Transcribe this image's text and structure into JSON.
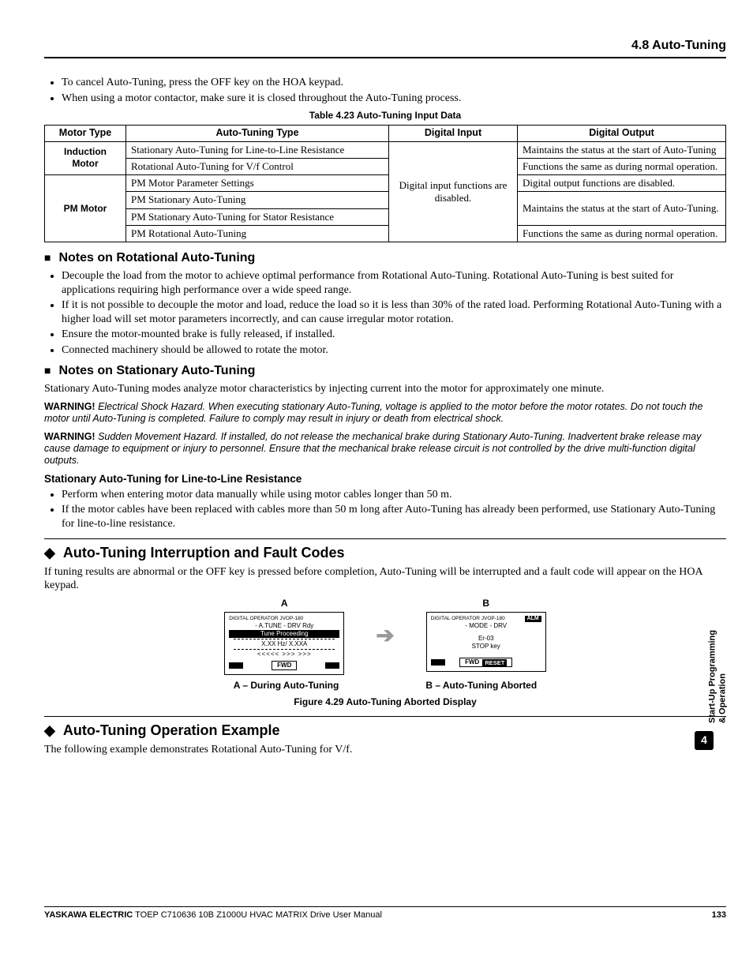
{
  "header": {
    "section": "4.8 Auto-Tuning"
  },
  "intro_bullets": [
    "To cancel Auto-Tuning, press the OFF key on the HOA keypad.",
    "When using a motor contactor, make sure it is closed throughout the Auto-Tuning process."
  ],
  "table": {
    "caption": "Table 4.23  Auto-Tuning Input Data",
    "headers": [
      "Motor Type",
      "Auto-Tuning Type",
      "Digital Input",
      "Digital Output"
    ],
    "digital_input_text": "Digital input functions are disabled.",
    "rows": [
      {
        "motor_type": "Induction Motor",
        "tuning": "Stationary Auto-Tuning for Line-to-Line Resistance",
        "output": "Maintains the status at the start of Auto-Tuning"
      },
      {
        "tuning": "Rotational Auto-Tuning for V/f Control",
        "output": "Functions the same as during normal operation."
      },
      {
        "motor_type": "PM Motor",
        "tuning": "PM Motor Parameter Settings",
        "output": "Digital output functions are disabled."
      },
      {
        "tuning": "PM Stationary Auto-Tuning",
        "output_merged": "Maintains the status at the start of Auto-Tuning."
      },
      {
        "tuning": "PM Stationary Auto-Tuning for Stator Resistance"
      },
      {
        "tuning": "PM Rotational Auto-Tuning",
        "output": "Functions the same as during normal operation."
      }
    ]
  },
  "sec_rotational": {
    "title": "Notes on Rotational Auto-Tuning",
    "bullets": [
      "Decouple the load from the motor to achieve optimal performance from Rotational Auto-Tuning. Rotational Auto-Tuning is best suited for applications requiring high performance over a wide speed range.",
      "If it is not possible to decouple the motor and load, reduce the load so it is less than 30% of the rated load. Performing Rotational Auto-Tuning with a higher load will set motor parameters incorrectly, and can cause irregular motor rotation.",
      "Ensure the motor-mounted brake is fully released, if installed.",
      "Connected machinery should be allowed to rotate the motor."
    ]
  },
  "sec_stationary": {
    "title": "Notes on Stationary Auto-Tuning",
    "intro": "Stationary Auto-Tuning modes analyze motor characteristics by injecting current into the motor for approximately one minute.",
    "warnings": [
      {
        "lead": "WARNING!",
        "body": "Electrical Shock Hazard. When executing stationary Auto-Tuning, voltage is applied to the motor before the motor rotates. Do not touch the motor until Auto-Tuning is completed. Failure to comply may result in injury or death from electrical shock."
      },
      {
        "lead": "WARNING!",
        "body": "Sudden Movement Hazard. If installed, do not release the mechanical brake during Stationary Auto-Tuning. Inadvertent brake release may cause damage to equipment or injury to personnel. Ensure that the mechanical brake release circuit is not controlled by the drive multi-function digital outputs."
      }
    ],
    "sub_title": "Stationary Auto-Tuning for Line-to-Line Resistance",
    "sub_bullets": [
      "Perform when entering motor data manually while using motor cables longer than 50 m.",
      "If the motor cables have been replaced with cables more than 50 m long after Auto-Tuning has already been performed, use Stationary Auto-Tuning for line-to-line resistance."
    ]
  },
  "sec_interrupt": {
    "title": "Auto-Tuning Interruption and Fault Codes",
    "intro": "If tuning results are abnormal or the OFF key is pressed before completion, Auto-Tuning will be interrupted and a fault code will appear on the HOA keypad.",
    "figure": {
      "labelA": "A",
      "labelB": "B",
      "panelA": {
        "top_left": "DIGITAL OPERATOR  JVOP-180",
        "top_right": "",
        "line1": "- A.TUNE -   DRV   Rdy",
        "inv": "Tune Proceeding",
        "line2": "X.XX Hz/  X.XXA",
        "sym": "<<<<<    >>>   >>>",
        "fwd": "FWD",
        "reset": ""
      },
      "panelB": {
        "top_left": "DIGITAL OPERATOR  JVOP-180",
        "top_right": "ALM",
        "line1": "- MODE -        DRV",
        "line2": "Er-03",
        "line3": "STOP  key",
        "fwd": "FWD",
        "reset": "RESET"
      },
      "captionA": "A – During Auto-Tuning",
      "captionB": "B – Auto-Tuning Aborted",
      "main_caption": "Figure 4.29  Auto-Tuning Aborted Display"
    }
  },
  "sec_example": {
    "title": "Auto-Tuning Operation Example",
    "intro": "The following example demonstrates Rotational Auto-Tuning for V/f."
  },
  "side_tab": {
    "line1": "Start-Up Programming",
    "line2": "& Operation",
    "num": "4"
  },
  "footer": {
    "brand": "YASKAWA ELECTRIC",
    "doc": " TOEP C710636 10B Z1000U HVAC MATRIX Drive User Manual",
    "page": "133"
  }
}
